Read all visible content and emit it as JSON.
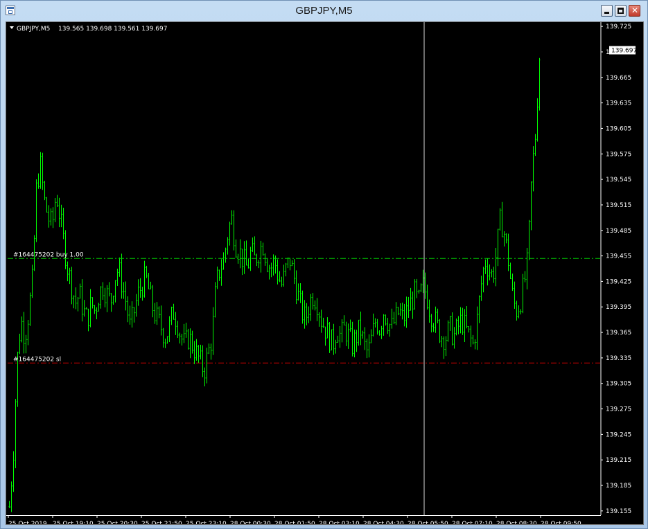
{
  "window": {
    "title": "GBPJPY,M5"
  },
  "chart": {
    "header": {
      "symbol": "GBPJPY,M5",
      "ohlc": "139.565 139.698 139.561 139.697"
    },
    "current_price_label": "139.697",
    "order_lines": {
      "buy_label": "#164475202 buy 1.00",
      "sl_label": "#164475202 sl"
    },
    "colors": {
      "background": "#000000",
      "candle": "#00ff00",
      "buy_line": "#00c800",
      "sl_line": "#d00000",
      "crosshair": "#d8d8d8",
      "axis": "#ffffff"
    }
  },
  "chart_data": {
    "type": "candlestick",
    "symbol": "GBPJPY",
    "timeframe": "M5",
    "ylim": [
      139.15,
      139.73
    ],
    "y_ticks": [
      139.725,
      139.695,
      139.665,
      139.635,
      139.605,
      139.575,
      139.545,
      139.515,
      139.485,
      139.455,
      139.425,
      139.395,
      139.365,
      139.335,
      139.305,
      139.275,
      139.245,
      139.215,
      139.185,
      139.155
    ],
    "x_ticks": [
      "25 Oct 2019",
      "25 Oct 19:10",
      "25 Oct 20:30",
      "25 Oct 21:50",
      "25 Oct 23:10",
      "28 Oct 00:30",
      "28 Oct 01:50",
      "28 Oct 03:10",
      "28 Oct 04:30",
      "28 Oct 05:50",
      "28 Oct 07:10",
      "28 Oct 08:30",
      "28 Oct 09:50"
    ],
    "buy_price": 139.452,
    "sl_price": 139.329,
    "last_price": 139.697,
    "close_profile": [
      139.16,
      139.22,
      139.33,
      139.38,
      139.36,
      139.39,
      139.43,
      139.54,
      139.56,
      139.52,
      139.5,
      139.49,
      139.53,
      139.5,
      139.47,
      139.44,
      139.42,
      139.4,
      139.41,
      139.39,
      139.38,
      139.4,
      139.39,
      139.41,
      139.42,
      139.41,
      139.4,
      139.43,
      139.44,
      139.42,
      139.4,
      139.37,
      139.39,
      139.41,
      139.42,
      139.43,
      139.41,
      139.39,
      139.38,
      139.37,
      139.36,
      139.37,
      139.39,
      139.38,
      139.36,
      139.35,
      139.36,
      139.35,
      139.34,
      139.33,
      139.32,
      139.34,
      139.36,
      139.42,
      139.44,
      139.45,
      139.48,
      139.5,
      139.47,
      139.46,
      139.45,
      139.44,
      139.46,
      139.45,
      139.46,
      139.47,
      139.45,
      139.44,
      139.45,
      139.43,
      139.42,
      139.44,
      139.45,
      139.43,
      139.41,
      139.39,
      139.38,
      139.4,
      139.41,
      139.4,
      139.38,
      139.37,
      139.36,
      139.35,
      139.37,
      139.36,
      139.37,
      139.36,
      139.35,
      139.36,
      139.37,
      139.35,
      139.34,
      139.36,
      139.38,
      139.37,
      139.39,
      139.38,
      139.37,
      139.38,
      139.39,
      139.38,
      139.39,
      139.4,
      139.41,
      139.4,
      139.42,
      139.41,
      139.39,
      139.38,
      139.37,
      139.36,
      139.36,
      139.37,
      139.36,
      139.37,
      139.38,
      139.37,
      139.36,
      139.35,
      139.38,
      139.42,
      139.45,
      139.44,
      139.43,
      139.46,
      139.5,
      139.48,
      139.45,
      139.41,
      139.39,
      139.4,
      139.42,
      139.45,
      139.55,
      139.6,
      139.69
    ]
  }
}
